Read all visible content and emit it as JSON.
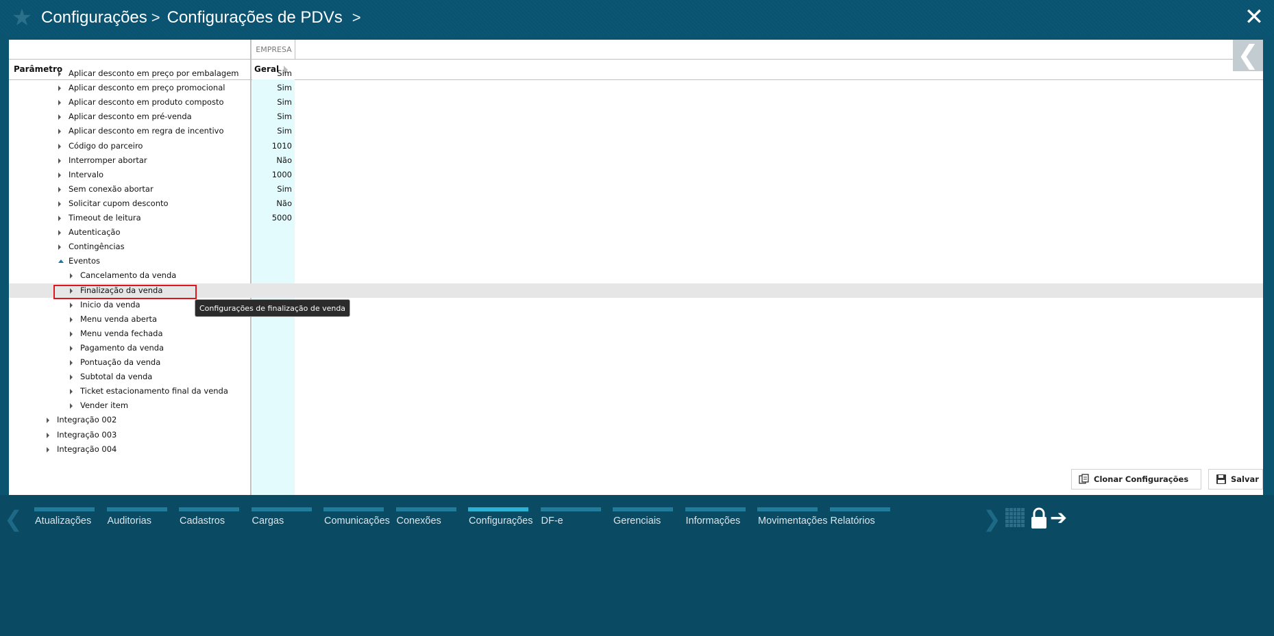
{
  "breadcrumb": {
    "items": [
      "Configurações",
      "Configurações de PDVs"
    ]
  },
  "table": {
    "group_header": "EMPRESA",
    "param_header": "Parâmetro",
    "value_header": "Geral",
    "rows": [
      {
        "label": "Aplicar desconto em preço por embalagem",
        "value": "Sim",
        "level": 2
      },
      {
        "label": "Aplicar desconto em preço promocional",
        "value": "Sim",
        "level": 2
      },
      {
        "label": "Aplicar desconto em produto composto",
        "value": "Sim",
        "level": 2
      },
      {
        "label": "Aplicar desconto em pré-venda",
        "value": "Sim",
        "level": 2
      },
      {
        "label": "Aplicar desconto em regra de incentivo",
        "value": "Sim",
        "level": 2
      },
      {
        "label": "Código do parceiro",
        "value": "1010",
        "level": 2
      },
      {
        "label": "Interromper abortar",
        "value": "Não",
        "level": 2
      },
      {
        "label": "Intervalo",
        "value": "1000",
        "level": 2
      },
      {
        "label": "Sem conexão abortar",
        "value": "Sim",
        "level": 2
      },
      {
        "label": "Solicitar cupom desconto",
        "value": "Não",
        "level": 2
      },
      {
        "label": "Timeout de leitura",
        "value": "5000",
        "level": 2
      },
      {
        "label": "Autenticação",
        "value": "",
        "level": 2
      },
      {
        "label": "Contingências",
        "value": "",
        "level": 2
      },
      {
        "label": "Eventos",
        "value": "",
        "level": 2,
        "expanded": true
      },
      {
        "label": "Cancelamento da venda",
        "value": "",
        "level": 3
      },
      {
        "label": "Finalização da venda",
        "value": "",
        "level": 3,
        "selected": true
      },
      {
        "label": "Inicio da venda",
        "value": "",
        "level": 3
      },
      {
        "label": "Menu venda aberta",
        "value": "",
        "level": 3
      },
      {
        "label": "Menu venda fechada",
        "value": "",
        "level": 3
      },
      {
        "label": "Pagamento da venda",
        "value": "",
        "level": 3
      },
      {
        "label": "Pontuação da venda",
        "value": "",
        "level": 3
      },
      {
        "label": "Subtotal da venda",
        "value": "",
        "level": 3
      },
      {
        "label": "Ticket estacionamento final da venda",
        "value": "",
        "level": 3
      },
      {
        "label": "Vender item",
        "value": "",
        "level": 3
      },
      {
        "label": "Integração 002",
        "value": "",
        "level": 1
      },
      {
        "label": "Integração 003",
        "value": "",
        "level": 1
      },
      {
        "label": "Integração 004",
        "value": "",
        "level": 1
      }
    ]
  },
  "tooltip": "Configurações de finalização de venda",
  "actions": {
    "clone_label": "Clonar Configurações",
    "save_label": "Salvar"
  },
  "nav": {
    "tabs": [
      "Atualizações",
      "Auditorias",
      "Cadastros",
      "Cargas",
      "Comunicações",
      "Conexões",
      "Configurações",
      "DF-e",
      "Gerenciais",
      "Informações",
      "Movimentações",
      "Relatórios"
    ],
    "active": "Configurações"
  },
  "colors": {
    "background": "#0a5470",
    "empresa_column": "#e3fbfc",
    "selection_box": "#e0141c",
    "nav_bar": "#1f7c9b",
    "nav_bar_active": "#2ab1d4"
  }
}
